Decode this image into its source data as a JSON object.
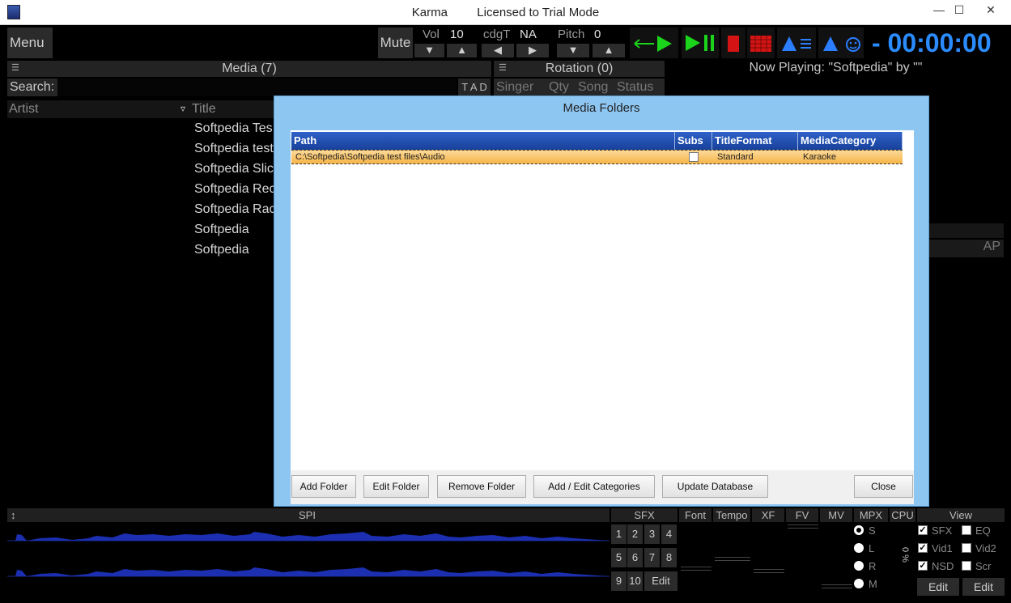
{
  "window": {
    "app_name": "Karma",
    "license": "Licensed to Trial Mode",
    "minimize": "—",
    "maximize": "☐",
    "close": "✕"
  },
  "toolbar": {
    "menu": "Menu",
    "mute": "Mute",
    "vol_label": "Vol",
    "vol_value": "10",
    "cdgt_label": "cdgT",
    "cdgt_value": "NA",
    "pitch_label": "Pitch",
    "pitch_value": "0",
    "down": "▼",
    "up": "▲",
    "left": "◀",
    "right": "▶",
    "timer": "- 00:00:00",
    "accent_green": "#1bd41b",
    "accent_red": "#d41414",
    "accent_blue": "#2b7fff"
  },
  "media": {
    "header": "Media (7)",
    "menu_icon": "☰",
    "search_label": "Search:",
    "tad": "T A D",
    "col_artist": "Artist",
    "col_title": "Title",
    "sort_icon": "▿",
    "titles": [
      "Softpedia Tes",
      "Softpedia test",
      "Softpedia Slic",
      "Softpedia Rec",
      "Softpedia Rac",
      "Softpedia",
      "Softpedia"
    ]
  },
  "rotation": {
    "header": "Rotation (0)",
    "menu_icon": "☰",
    "col_singer": "Singer",
    "col_qty": "Qty",
    "col_song": "Song",
    "col_status": "Status"
  },
  "now_playing": {
    "label": "Now Playing:",
    "value": "\"Softpedia\" by \"\"",
    "ap": "AP"
  },
  "dialog": {
    "title": "Media Folders",
    "columns": [
      "Path",
      "Subs",
      "TitleFormat",
      "MediaCategory"
    ],
    "rows": [
      {
        "path": "C:\\Softpedia\\Softpedia test files\\Audio",
        "subs": false,
        "title_format": "Standard",
        "category": "Karaoke"
      }
    ],
    "buttons": {
      "add_folder": "Add Folder",
      "edit_folder": "Edit Folder",
      "remove_folder": "Remove Folder",
      "add_edit_categories": "Add / Edit Categories",
      "update_database": "Update Database",
      "close": "Close"
    }
  },
  "bottom": {
    "resize_icon": "↕",
    "spi": "SPI",
    "sfx": "SFX",
    "font": "Font",
    "tempo": "Tempo",
    "xf": "XF",
    "fv": "FV",
    "mv": "MV",
    "mpx": "MPX",
    "cpu": "CPU",
    "view": "View",
    "cpu_value": "0 %",
    "pad_buttons": [
      "1",
      "2",
      "3",
      "4",
      "5",
      "6",
      "7",
      "8",
      "9",
      "10"
    ],
    "edit": "Edit",
    "radios": [
      {
        "label": "S",
        "selected": true
      },
      {
        "label": "L",
        "selected": false
      },
      {
        "label": "R",
        "selected": false
      },
      {
        "label": "M",
        "selected": false
      }
    ],
    "view_checks_left": [
      {
        "label": "SFX",
        "checked": true
      },
      {
        "label": "Vid1",
        "checked": true
      },
      {
        "label": "NSD",
        "checked": true
      }
    ],
    "view_checks_right": [
      {
        "label": "EQ",
        "checked": false
      },
      {
        "label": "Vid2",
        "checked": false
      },
      {
        "label": "Scr",
        "checked": false
      }
    ],
    "edit_left": "Edit",
    "edit_right": "Edit"
  }
}
